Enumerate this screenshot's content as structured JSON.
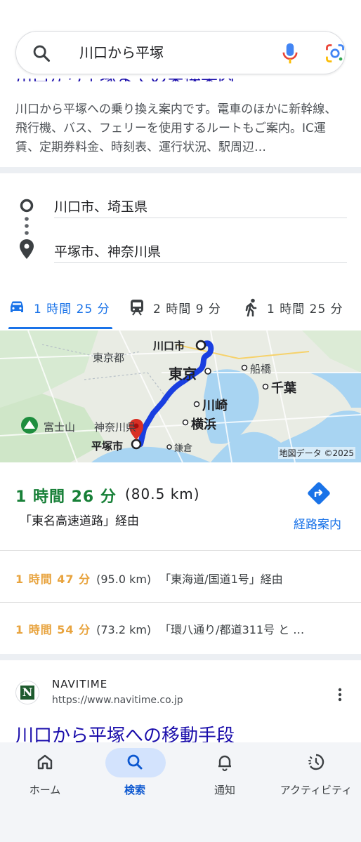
{
  "search": {
    "query": "川口から平塚",
    "icons": [
      "search-icon",
      "mic-icon",
      "google-lens-icon"
    ]
  },
  "snippet": {
    "title": "川口から平塚までの乗換案内",
    "text": "川口から平塚への乗り換え案内です。電車のほかに新幹線、飛行機、バス、フェリーを使用するルートもご案内。IC運賃、定期券料金、時刻表、運行状況、駅周辺…"
  },
  "directions": {
    "origin": "川口市、埼玉県",
    "destination": "平塚市、神奈川県",
    "modes": [
      {
        "icon": "car-icon",
        "label": "1 時間 25 分",
        "active": true
      },
      {
        "icon": "train-icon",
        "label": "2 時間 9 分",
        "active": false
      },
      {
        "icon": "walk-icon",
        "label": "1 時間 25 分",
        "active": false
      }
    ]
  },
  "map": {
    "labels": {
      "kawaguchi": "川口市",
      "tokyo_to": "東京都",
      "tokyo": "東京",
      "funabashi": "船橋",
      "chiba": "千葉",
      "kawasaki": "川崎",
      "yokohama": "横浜",
      "fujisan": "富士山",
      "kanagawa": "神奈川県",
      "hiratsuka": "平塚市",
      "kamakura": "鎌倉"
    },
    "attribution": "地図データ ©2025",
    "colors": {
      "route": "#1a3fe0",
      "destination_pin": "#d93025",
      "water": "#a8d4f2",
      "land": "#e8ebe6"
    }
  },
  "routes": {
    "main": {
      "time": "1 時間 26 分",
      "distance": "(80.5 km)",
      "via": "「東名高速道路」経由",
      "directions_button": "経路案内"
    },
    "alternatives": [
      {
        "time": "1 時間 47 分",
        "distance": "(95.0 km)",
        "via": "「東海道/国道1号」経由"
      },
      {
        "time": "1 時間 54 分",
        "distance": "(73.2 km)",
        "via": "「環八通り/都道311号 と …"
      }
    ]
  },
  "result": {
    "site_name": "NAVITIME",
    "url": "https://www.navitime.co.jp",
    "favicon_letter": "N",
    "title": "川口から平塚への移動手段"
  },
  "bottom_nav": {
    "items": [
      {
        "icon": "home-icon",
        "label": "ホーム",
        "active": false
      },
      {
        "icon": "search-icon",
        "label": "検索",
        "active": true
      },
      {
        "icon": "bell-icon",
        "label": "通知",
        "active": false
      },
      {
        "icon": "activity-icon",
        "label": "アクティビティ",
        "active": false
      }
    ]
  }
}
